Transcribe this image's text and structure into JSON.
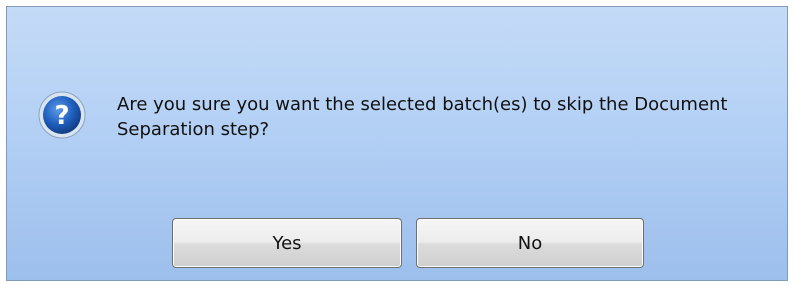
{
  "dialog": {
    "icon": "question-icon",
    "message": "Are you sure you want the selected batch(es) to skip the Document Separation step?",
    "buttons": {
      "yes_label": "Yes",
      "no_label": "No"
    }
  },
  "colors": {
    "background_top": "#c4dbf7",
    "background_bottom": "#9dbfec",
    "icon_fill": "#1f5fbf",
    "icon_ring": "#d8e4f0"
  }
}
